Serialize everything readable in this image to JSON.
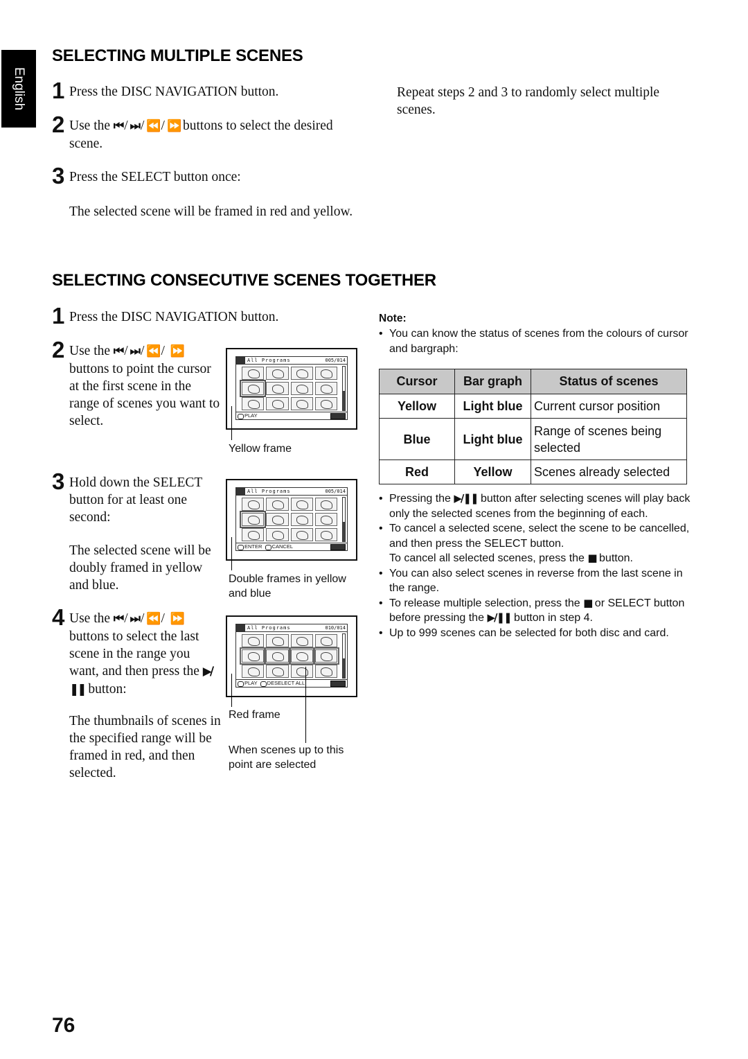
{
  "language_tab": "English",
  "page_number": "76",
  "icons": {
    "prev_chapter": "⏮",
    "next_chapter": "⏭",
    "rewind": "⏪",
    "fast_forward": "⏩",
    "play_pause": "▶/❚❚",
    "stop": "■"
  },
  "section1": {
    "heading": "SELECTING MULTIPLE SCENES",
    "steps": [
      {
        "num": "1",
        "text": "Press the DISC NAVIGATION button."
      },
      {
        "num": "2",
        "text_before": "Use the",
        "text_after": "buttons to select the desired scene."
      },
      {
        "num": "3",
        "text": "Press the SELECT button once:",
        "detail": "The selected scene will be framed in red and yellow."
      }
    ],
    "right_note": "Repeat steps 2 and 3 to randomly select multiple scenes."
  },
  "section2": {
    "heading": "SELECTING CONSECUTIVE SCENES TOGETHER",
    "steps": [
      {
        "num": "1",
        "text": "Press the DISC NAVIGATION button."
      },
      {
        "num": "2",
        "text_before": "Use the",
        "text_after": "buttons to point the cursor at the first scene in the range of scenes you want to select."
      },
      {
        "num": "3",
        "text": "Hold down the SELECT button for at least one second:",
        "detail": "The selected scene will be doubly framed in yellow and blue."
      },
      {
        "num": "4",
        "text_before": "Use the",
        "text_mid": "buttons to select the last scene in the range you want, and then press the",
        "text_after": "button:",
        "detail": "The thumbnails of scenes in the specified range will be framed in red, and then selected."
      }
    ],
    "screens": [
      {
        "title": "All Programs",
        "counter": "005/014",
        "footer_left": "PLAY",
        "footer_right": "",
        "scroll_fraction": 0.45,
        "caption": "Yellow frame"
      },
      {
        "title": "All Programs",
        "counter": "005/014",
        "footer_left": "ENTER",
        "footer_right": "CANCEL",
        "scroll_fraction": 0.45,
        "caption": "Double frames in yellow and blue"
      },
      {
        "title": "All Programs",
        "counter": "010/014",
        "footer_left": "PLAY",
        "footer_right": "DESELECT ALL",
        "scroll_fraction": 0.45,
        "caption": "Red frame",
        "caption2": "When scenes up to this point are selected"
      }
    ]
  },
  "note": {
    "title": "Note:",
    "intro": "You can know the status of scenes from the colours of cursor and bargraph:",
    "table": {
      "headers": [
        "Cursor",
        "Bar graph",
        "Status of scenes"
      ],
      "rows": [
        [
          "Yellow",
          "Light blue",
          "Current cursor position"
        ],
        [
          "Blue",
          "Light blue",
          "Range of scenes being selected"
        ],
        [
          "Red",
          "Yellow",
          "Scenes already selected"
        ]
      ]
    },
    "bullets": [
      {
        "before": "Pressing the",
        "after": "button after selecting scenes will play back only the selected scenes from the beginning of each."
      },
      {
        "text": "To cancel a selected scene, select the scene to be cancelled, and then press the SELECT button.",
        "extra_before": "To cancel all selected scenes, press the",
        "extra_after": "button."
      },
      {
        "text": "You can also select scenes in reverse from the last scene in the range."
      },
      {
        "before": "To release multiple selection, press the",
        "mid": "or SELECT button before pressing the",
        "after": "button in step 4."
      },
      {
        "text": "Up to 999 scenes can be selected for both disc and card."
      }
    ]
  }
}
